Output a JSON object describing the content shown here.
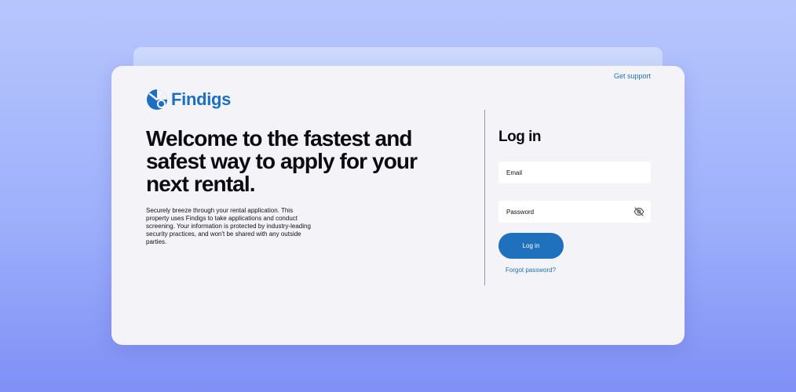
{
  "header": {
    "support_link": "Get support"
  },
  "brand": {
    "name": "Findigs",
    "logo_icon": "findigs-logo-icon",
    "color": "#1d6fc2"
  },
  "hero": {
    "headline": "Welcome to the fastest and safest way to apply for your next rental.",
    "description": "Securely breeze through your rental application. This property uses Findigs to take applications and conduct screening. Your information is protected by industry-leading security practices, and won't be shared with any outside parties."
  },
  "login": {
    "title": "Log in",
    "email_placeholder": "Email",
    "password_placeholder": "Password",
    "password_toggle_icon": "eye-off-icon",
    "submit_label": "Log in",
    "forgot_password_link": "Forgot password?"
  },
  "colors": {
    "accent": "#1f71bd",
    "link": "#1b6fb8",
    "card_background": "#f4f4f8"
  }
}
